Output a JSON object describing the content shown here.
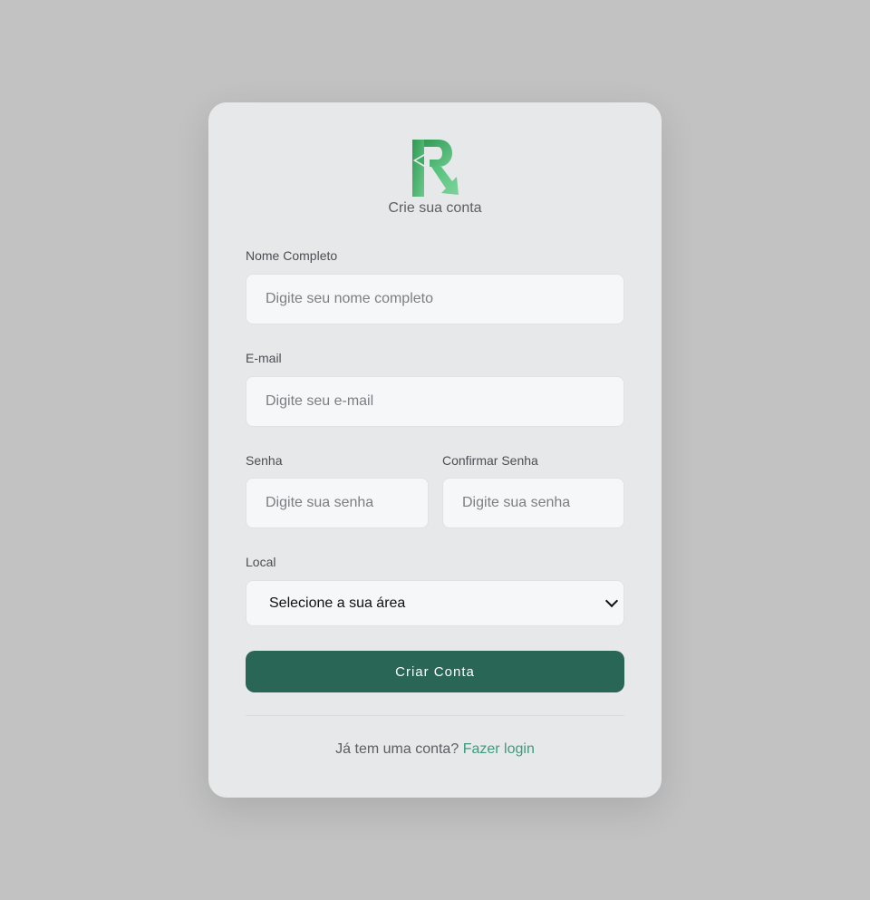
{
  "header": {
    "subtitle": "Crie sua conta"
  },
  "form": {
    "name_label": "Nome Completo",
    "name_placeholder": "Digite seu nome completo",
    "email_label": "E-mail",
    "email_placeholder": "Digite seu e-mail",
    "password_label": "Senha",
    "password_placeholder": "Digite sua senha",
    "confirm_label": "Confirmar Senha",
    "confirm_placeholder": "Digite sua senha",
    "location_label": "Local",
    "location_selected": "Selecione a sua área",
    "submit_label": "Criar Conta"
  },
  "footer": {
    "prompt": "Já tem uma conta?",
    "login_link": "Fazer login"
  },
  "colors": {
    "background": "#c2c2c2",
    "card": "#e7e8ea",
    "primary": "#2a6655",
    "link": "#3f9a7c",
    "logo_green": "#3fae63"
  }
}
